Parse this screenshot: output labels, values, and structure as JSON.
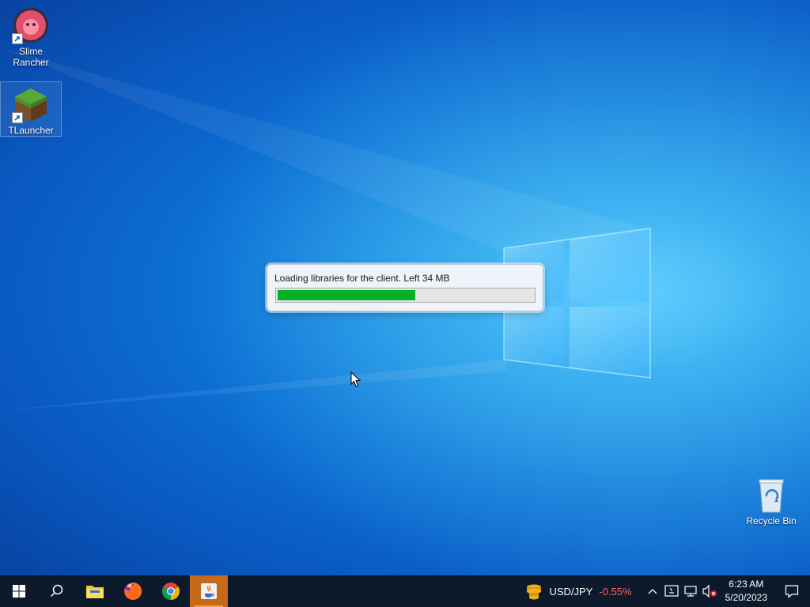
{
  "desktop": {
    "icons": [
      {
        "id": "slime-rancher",
        "label": "Slime Rancher"
      },
      {
        "id": "tlauncher",
        "label": "TLauncher"
      },
      {
        "id": "recycle-bin",
        "label": "Recycle Bin"
      }
    ]
  },
  "progress_dialog": {
    "message": "Loading libraries for the client. Left 34 MB",
    "progress_percent": 54
  },
  "taskbar": {
    "apps": [
      {
        "name": "start",
        "icon": "windows-logo-icon"
      },
      {
        "name": "search",
        "icon": "search-icon"
      },
      {
        "name": "file-explorer",
        "icon": "folder-icon"
      },
      {
        "name": "firefox",
        "icon": "firefox-icon"
      },
      {
        "name": "chrome",
        "icon": "chrome-icon"
      },
      {
        "name": "java",
        "icon": "java-icon"
      }
    ],
    "widget": {
      "pair": "USD/JPY",
      "change": "-0.55%"
    },
    "clock": {
      "time": "6:23 AM",
      "date": "5/20/2023"
    }
  },
  "colors": {
    "progress_fill": "#06b025",
    "taskbar_bg": "#0d1a2b",
    "active_app": "#c46a19",
    "negative_change": "#ff5f5f"
  }
}
